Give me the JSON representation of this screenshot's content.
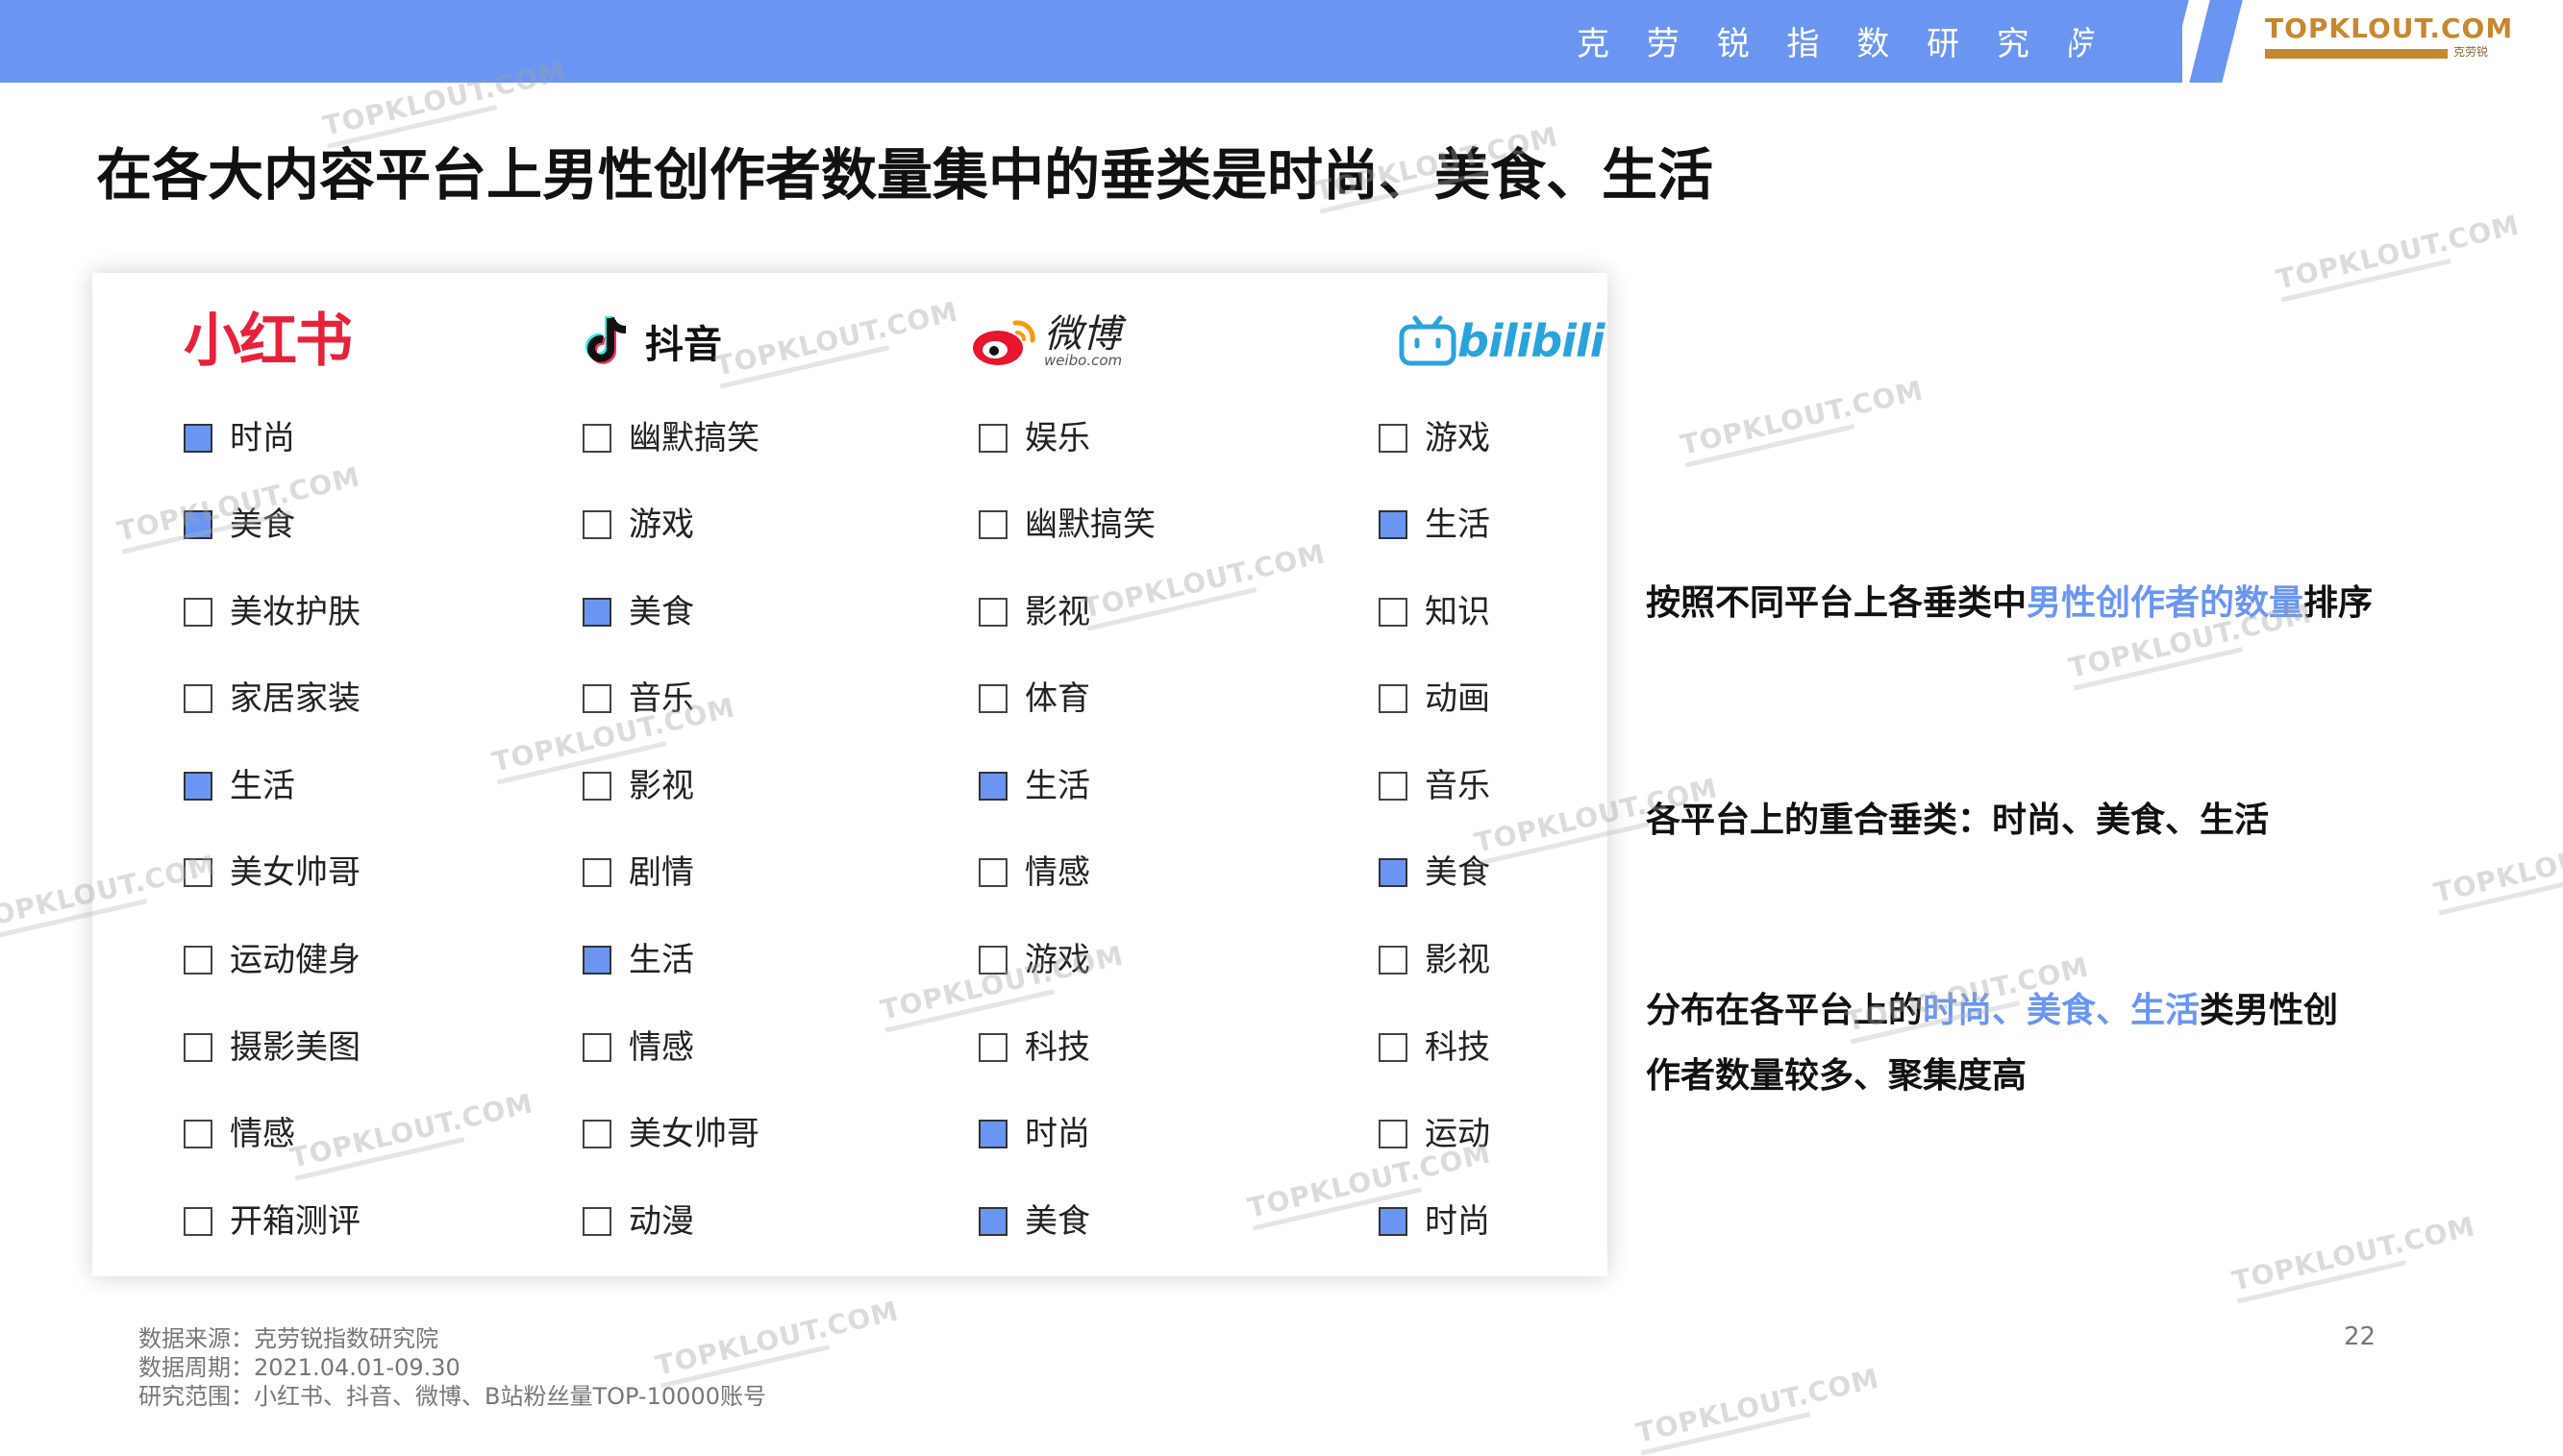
{
  "header": {
    "institute": "克 劳 锐 指 数 研 究 院",
    "logo_text": "TOPKLOUT.COM",
    "logo_brand": "克劳锐"
  },
  "title": "在各大内容平台上男性创作者数量集中的垂类是时尚、美食、生活",
  "platforms": [
    {
      "name": "小红书",
      "items": [
        {
          "label": "时尚",
          "checked": true
        },
        {
          "label": "美食",
          "checked": true
        },
        {
          "label": "美妆护肤",
          "checked": false
        },
        {
          "label": "家居家装",
          "checked": false
        },
        {
          "label": "生活",
          "checked": true
        },
        {
          "label": "美女帅哥",
          "checked": false
        },
        {
          "label": "运动健身",
          "checked": false
        },
        {
          "label": "摄影美图",
          "checked": false
        },
        {
          "label": "情感",
          "checked": false
        },
        {
          "label": "开箱测评",
          "checked": false
        }
      ]
    },
    {
      "name": "抖音",
      "items": [
        {
          "label": "幽默搞笑",
          "checked": false
        },
        {
          "label": "游戏",
          "checked": false
        },
        {
          "label": "美食",
          "checked": true
        },
        {
          "label": "音乐",
          "checked": false
        },
        {
          "label": "影视",
          "checked": false
        },
        {
          "label": "剧情",
          "checked": false
        },
        {
          "label": "生活",
          "checked": true
        },
        {
          "label": "情感",
          "checked": false
        },
        {
          "label": "美女帅哥",
          "checked": false
        },
        {
          "label": "动漫",
          "checked": false
        }
      ]
    },
    {
      "name": "微博",
      "domain": "weibo.com",
      "items": [
        {
          "label": "娱乐",
          "checked": false
        },
        {
          "label": "幽默搞笑",
          "checked": false
        },
        {
          "label": "影视",
          "checked": false
        },
        {
          "label": "体育",
          "checked": false
        },
        {
          "label": "生活",
          "checked": true
        },
        {
          "label": "情感",
          "checked": false
        },
        {
          "label": "游戏",
          "checked": false
        },
        {
          "label": "科技",
          "checked": false
        },
        {
          "label": "时尚",
          "checked": true
        },
        {
          "label": "美食",
          "checked": true
        }
      ]
    },
    {
      "name": "bilibili",
      "items": [
        {
          "label": "游戏",
          "checked": false
        },
        {
          "label": "生活",
          "checked": true
        },
        {
          "label": "知识",
          "checked": false
        },
        {
          "label": "动画",
          "checked": false
        },
        {
          "label": "音乐",
          "checked": false
        },
        {
          "label": "美食",
          "checked": true
        },
        {
          "label": "影视",
          "checked": false
        },
        {
          "label": "科技",
          "checked": false
        },
        {
          "label": "运动",
          "checked": false
        },
        {
          "label": "时尚",
          "checked": true
        }
      ]
    }
  ],
  "notes": {
    "note1": {
      "pre": "按照不同平台上各垂类中",
      "hl": "男性创作者的数量",
      "post": "排序"
    },
    "note2": "各平台上的重合垂类：时尚、美食、生活",
    "note3": {
      "pre": "分布在各平台上的",
      "hl": "时尚、美食、生活",
      "post": "类男性创",
      "line2": "作者数量较多、聚集度高"
    }
  },
  "footer": {
    "source": "数据来源：克劳锐指数研究院",
    "period": "数据周期：2021.04.01-09.30",
    "scope": "研究范围：小红书、抖音、微博、B站粉丝量TOP-10000账号",
    "page": "22"
  },
  "watermark": "TOPKLOUT.COM",
  "colors": {
    "accent": "#6a96f2",
    "xhs_red": "#e8213a",
    "bili_blue": "#2aa3dc",
    "logo_gold": "#c7872e"
  }
}
